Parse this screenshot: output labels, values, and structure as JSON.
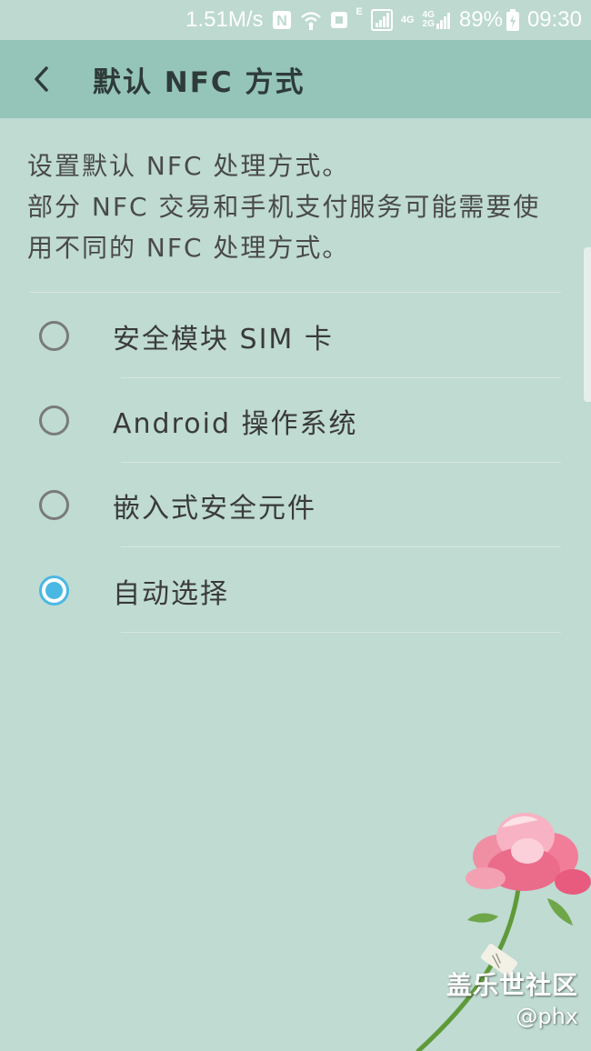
{
  "status_bar": {
    "net_speed": "1.51M/s",
    "nfc_letter": "N",
    "e_label": "E",
    "lte_label": "4G",
    "stack_top": "4G",
    "stack_bottom": "2G",
    "battery": "89%",
    "time": "09:30"
  },
  "app_bar": {
    "title": "默认 NFC 方式"
  },
  "description": {
    "line1": "设置默认 NFC 处理方式。",
    "line2": "部分 NFC 交易和手机支付服务可能需要使用不同的 NFC 处理方式。"
  },
  "options": [
    {
      "label": "安全模块 SIM 卡",
      "selected": false
    },
    {
      "label": "Android 操作系统",
      "selected": false
    },
    {
      "label": "嵌入式安全元件",
      "selected": false
    },
    {
      "label": "自动选择",
      "selected": true
    }
  ],
  "watermark": {
    "line1": "盖乐世社区",
    "line2": "@phx"
  },
  "colors": {
    "background": "#bfdbd2",
    "app_bar": "#95c4b8",
    "accent": "#4ab8e4"
  }
}
